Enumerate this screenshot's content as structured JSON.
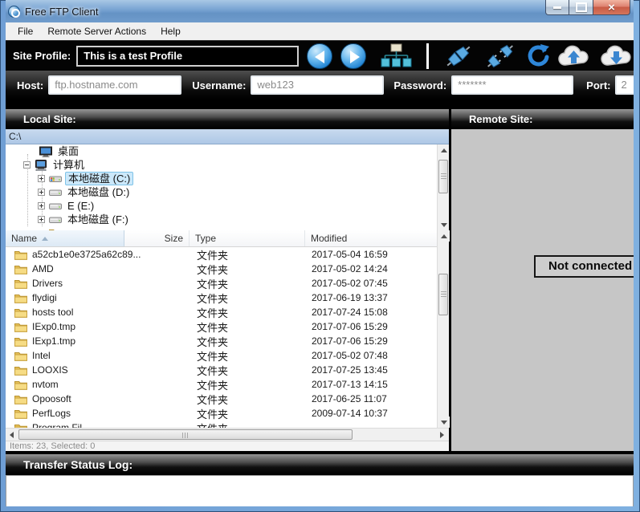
{
  "window": {
    "title": "Free FTP Client",
    "controls": [
      "minimize",
      "maximize",
      "close"
    ]
  },
  "menu": {
    "items": [
      "File",
      "Remote Server Actions",
      "Help"
    ]
  },
  "toolbar": {
    "site_profile_label": "Site Profile:",
    "site_profile_value": "This is a test Profile",
    "icons": [
      "back",
      "forward",
      "sitemap",
      "connect",
      "disconnect",
      "refresh",
      "cloud-upload",
      "cloud-download"
    ]
  },
  "connection": {
    "host_label": "Host:",
    "host_value": "ftp.hostname.com",
    "username_label": "Username:",
    "username_value": "web123",
    "password_label": "Password:",
    "password_value": "*******",
    "port_label": "Port:",
    "port_value": "2"
  },
  "local": {
    "header": "Local Site:",
    "path": "C:\\",
    "tree": [
      {
        "label": "桌面",
        "icon": "desktop",
        "level": 0,
        "expander": "",
        "selected": false
      },
      {
        "label": "计算机",
        "icon": "computer",
        "level": 1,
        "expander": "minus",
        "selected": false
      },
      {
        "label": "本地磁盘 (C:)",
        "icon": "disk-win",
        "level": 2,
        "expander": "plus",
        "selected": true
      },
      {
        "label": "本地磁盘 (D:)",
        "icon": "disk",
        "level": 2,
        "expander": "plus",
        "selected": false
      },
      {
        "label": "E (E:)",
        "icon": "disk",
        "level": 2,
        "expander": "plus",
        "selected": false
      },
      {
        "label": "本地磁盘 (F:)",
        "icon": "disk",
        "level": 2,
        "expander": "plus",
        "selected": false
      },
      {
        "label": "",
        "icon": "folder",
        "level": 2,
        "expander": "",
        "selected": false
      }
    ],
    "columns": [
      "Name",
      "Size",
      "Type",
      "Modified"
    ],
    "sort_column": "Name",
    "files": [
      {
        "name": "a52cb1e0e3725a62c89...",
        "size": "",
        "type": "文件夹",
        "modified": "2017-05-04 16:59"
      },
      {
        "name": "AMD",
        "size": "",
        "type": "文件夹",
        "modified": "2017-05-02 14:24"
      },
      {
        "name": "Drivers",
        "size": "",
        "type": "文件夹",
        "modified": "2017-05-02 07:45"
      },
      {
        "name": "flydigi",
        "size": "",
        "type": "文件夹",
        "modified": "2017-06-19 13:37"
      },
      {
        "name": "hosts tool",
        "size": "",
        "type": "文件夹",
        "modified": "2017-07-24 15:08"
      },
      {
        "name": "IExp0.tmp",
        "size": "",
        "type": "文件夹",
        "modified": "2017-07-06 15:29"
      },
      {
        "name": "IExp1.tmp",
        "size": "",
        "type": "文件夹",
        "modified": "2017-07-06 15:29"
      },
      {
        "name": "Intel",
        "size": "",
        "type": "文件夹",
        "modified": "2017-05-02 07:48"
      },
      {
        "name": "LOOXIS",
        "size": "",
        "type": "文件夹",
        "modified": "2017-07-25 13:45"
      },
      {
        "name": "nvtom",
        "size": "",
        "type": "文件夹",
        "modified": "2017-07-13 14:15"
      },
      {
        "name": "Opoosoft",
        "size": "",
        "type": "文件夹",
        "modified": "2017-06-25 11:07"
      },
      {
        "name": "PerfLogs",
        "size": "",
        "type": "文件夹",
        "modified": "2009-07-14 10:37"
      },
      {
        "name": "Program Fil...",
        "size": "",
        "type": "文件夹",
        "modified": ""
      }
    ],
    "status": "Items: 23, Selected: 0"
  },
  "remote": {
    "header": "Remote Site:",
    "status_message": "Not connected"
  },
  "transfer_log": {
    "header": "Transfer Status Log:"
  }
}
